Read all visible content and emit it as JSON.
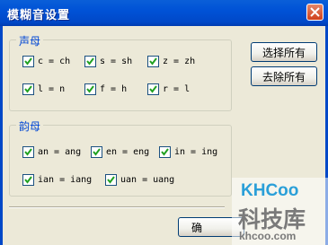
{
  "window": {
    "title": "模糊音设置"
  },
  "initials": {
    "legend": "声母",
    "items": [
      {
        "label": "c = ch",
        "checked": true
      },
      {
        "label": "s = sh",
        "checked": true
      },
      {
        "label": "z = zh",
        "checked": true
      },
      {
        "label": "l = n",
        "checked": true
      },
      {
        "label": "f = h",
        "checked": true
      },
      {
        "label": "r = l",
        "checked": true
      }
    ]
  },
  "finals": {
    "legend": "韵母",
    "items": [
      {
        "label": "an = ang",
        "checked": true
      },
      {
        "label": "en = eng",
        "checked": true
      },
      {
        "label": "in = ing",
        "checked": true
      },
      {
        "label": "ian = iang",
        "checked": true
      },
      {
        "label": "uan = uang",
        "checked": true
      }
    ]
  },
  "buttons": {
    "select_all": "选择所有",
    "remove_all": "去除所有",
    "bottom_partial": "确"
  },
  "watermark": {
    "logo": "KHCoo",
    "name": "科技库",
    "url": "khcoo.com"
  }
}
